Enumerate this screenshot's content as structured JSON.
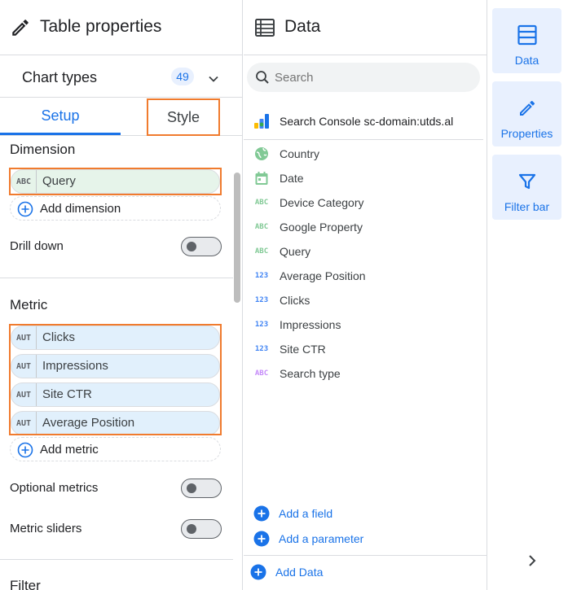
{
  "left_panel": {
    "title": "Table properties",
    "chart_types": {
      "label": "Chart types",
      "count": "49"
    },
    "tabs": {
      "setup": "Setup",
      "style": "Style"
    },
    "dimension": {
      "title": "Dimension",
      "chip": {
        "type": "ABC",
        "name": "Query"
      },
      "add_label": "Add dimension"
    },
    "drill_down": "Drill down",
    "metric": {
      "title": "Metric",
      "chips": [
        {
          "type": "AUT",
          "name": "Clicks"
        },
        {
          "type": "AUT",
          "name": "Impressions"
        },
        {
          "type": "AUT",
          "name": "Site CTR"
        },
        {
          "type": "AUT",
          "name": "Average Position"
        }
      ],
      "add_label": "Add metric"
    },
    "optional_metrics": "Optional metrics",
    "metric_sliders": "Metric sliders",
    "filter_title": "Filter"
  },
  "data_panel": {
    "title": "Data",
    "search_placeholder": "Search",
    "source": "Search Console sc-domain:utds.al",
    "fields": [
      {
        "icon": "globe-icon",
        "type": "",
        "name": "Country",
        "color": "#81c995"
      },
      {
        "icon": "calendar-icon",
        "type": "",
        "name": "Date",
        "color": "#81c995"
      },
      {
        "icon": "text-type-icon",
        "type": "ABC",
        "name": "Device Category",
        "color": "#81c995"
      },
      {
        "icon": "text-type-icon",
        "type": "ABC",
        "name": "Google Property",
        "color": "#81c995"
      },
      {
        "icon": "text-type-icon",
        "type": "ABC",
        "name": "Query",
        "color": "#81c995"
      },
      {
        "icon": "number-type-icon",
        "type": "123",
        "name": "Average Position",
        "color": "#4285f4"
      },
      {
        "icon": "number-type-icon",
        "type": "123",
        "name": "Clicks",
        "color": "#4285f4"
      },
      {
        "icon": "number-type-icon",
        "type": "123",
        "name": "Impressions",
        "color": "#4285f4"
      },
      {
        "icon": "number-type-icon",
        "type": "123",
        "name": "Site CTR",
        "color": "#4285f4"
      },
      {
        "icon": "text-type-icon",
        "type": "ABC",
        "name": "Search type",
        "color": "#c58af9"
      }
    ],
    "add_field": "Add a field",
    "add_parameter": "Add a parameter",
    "add_data": "Add Data"
  },
  "rail": {
    "data": "Data",
    "properties": "Properties",
    "filter_bar": "Filter bar"
  },
  "colors": {
    "accent": "#1a73e8",
    "highlight": "#f07b2e",
    "dim_chip": "#e6f4ea",
    "metric_chip": "#e1f0fc"
  }
}
